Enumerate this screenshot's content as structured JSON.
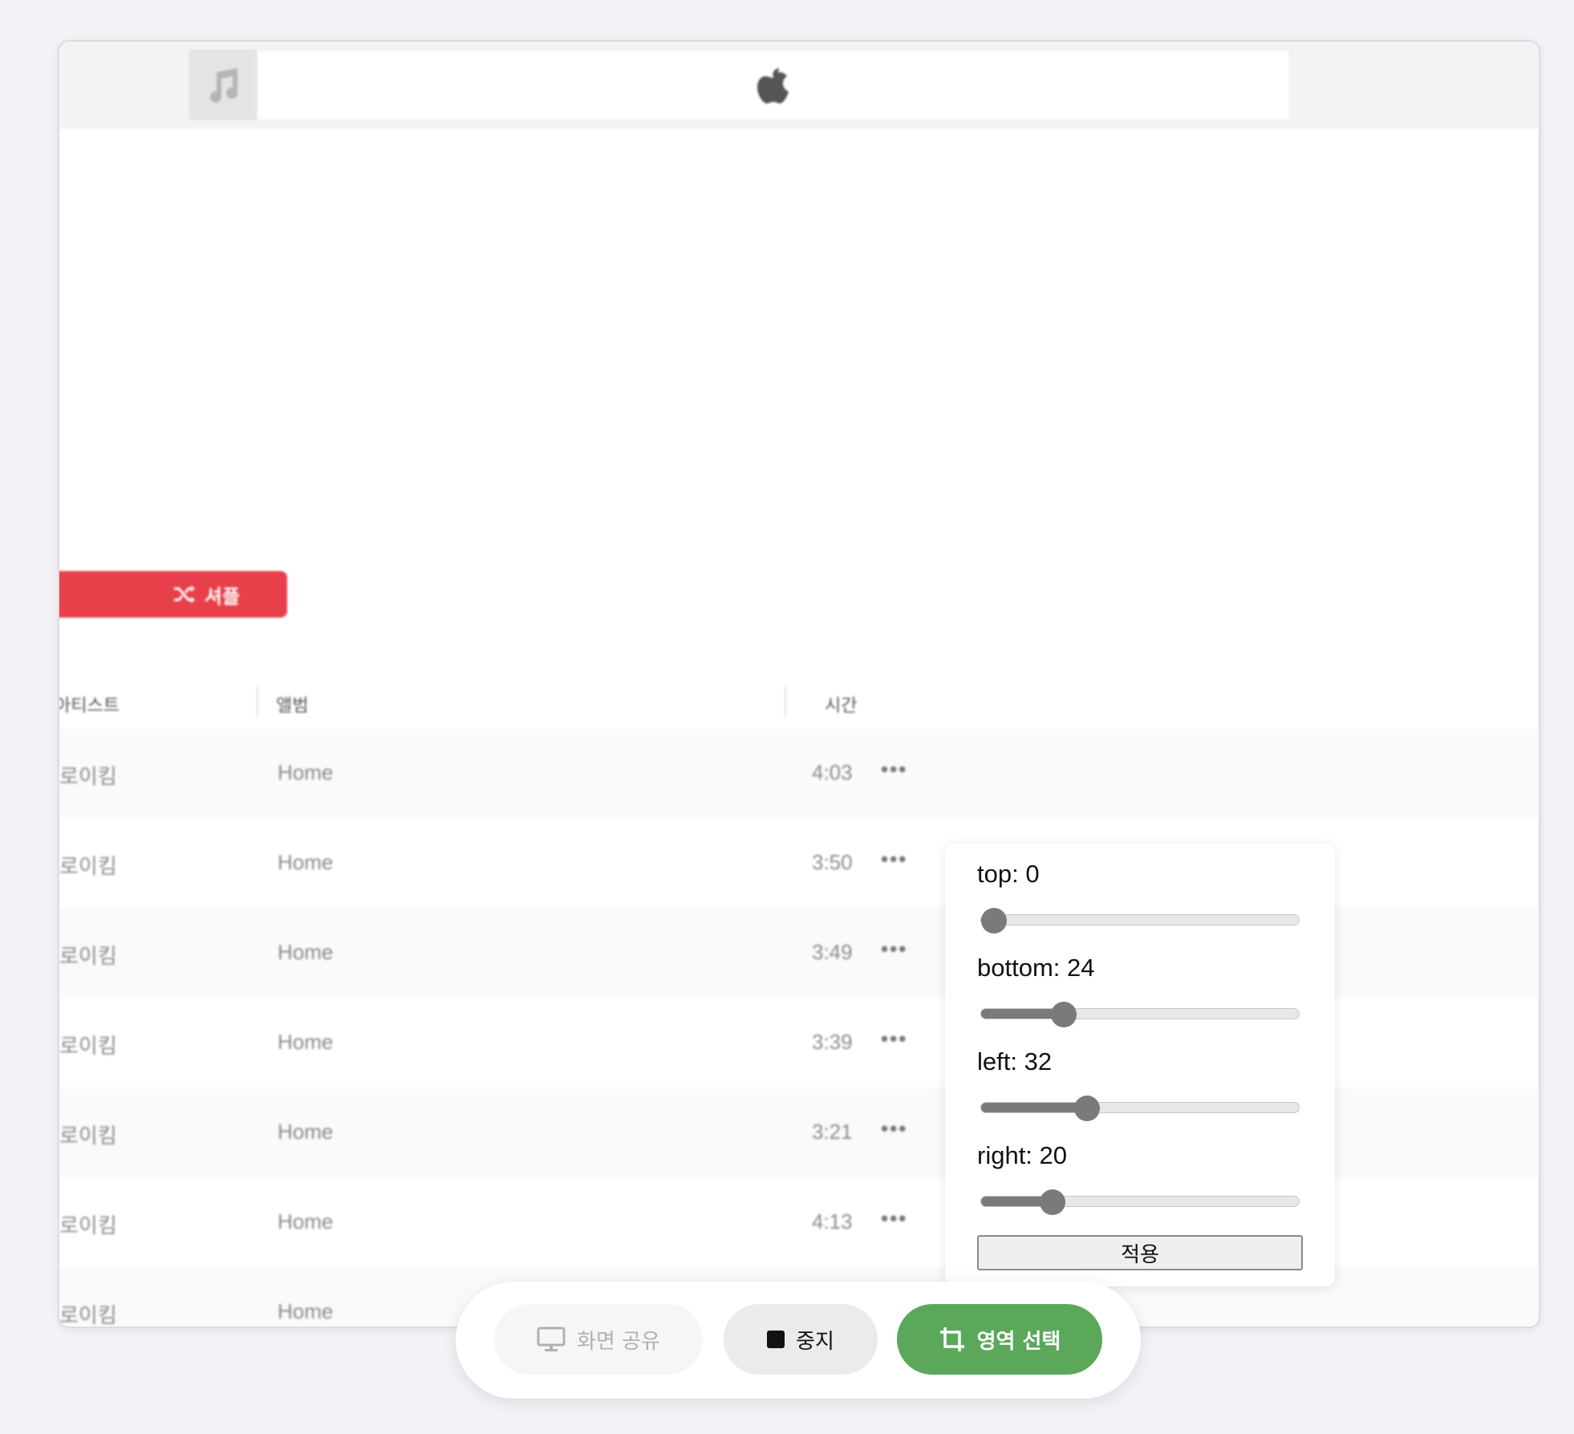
{
  "player": {
    "music_icon": "music-note-icon",
    "brand_icon": "apple-logo-icon",
    "play_button_label": "",
    "shuffle_button_label": "셔플"
  },
  "table": {
    "columns": [
      "아티스트",
      "앨범",
      "시간"
    ],
    "rows": [
      {
        "artist": "로이킴",
        "album": "Home",
        "time": "4:03"
      },
      {
        "artist": "로이킴",
        "album": "Home",
        "time": "3:50"
      },
      {
        "artist": "로이킴",
        "album": "Home",
        "time": "3:49"
      },
      {
        "artist": "로이킴",
        "album": "Home",
        "time": "3:39"
      },
      {
        "artist": "로이킴",
        "album": "Home",
        "time": "3:21"
      },
      {
        "artist": "로이킴",
        "album": "Home",
        "time": "4:13"
      },
      {
        "artist": "로이킴",
        "album": "Home",
        "time": ""
      }
    ],
    "more_label": "•••"
  },
  "crop_panel": {
    "sliders": [
      {
        "label": "top: 0",
        "value": 0,
        "max": 100
      },
      {
        "label": "bottom: 24",
        "value": 24,
        "max": 100
      },
      {
        "label": "left: 32",
        "value": 32,
        "max": 100
      },
      {
        "label": "right: 20",
        "value": 20,
        "max": 100
      }
    ],
    "apply_label": "적용"
  },
  "toolbar": {
    "share_label": "화면 공유",
    "stop_label": "중지",
    "select_label": "영역 선택",
    "accent_color": "#5ba85a"
  }
}
